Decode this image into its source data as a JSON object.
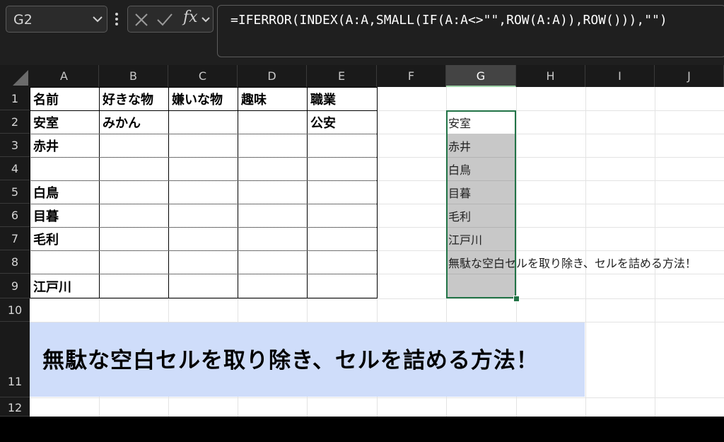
{
  "name_box": {
    "value": "G2"
  },
  "formula_bar": {
    "fx_label": "fx",
    "formula": "=IFERROR(INDEX(A:A,SMALL(IF(A:A<>\"\",ROW(A:A)),ROW())),\"\")"
  },
  "columns": [
    "A",
    "B",
    "C",
    "D",
    "E",
    "F",
    "G",
    "H",
    "I",
    "J"
  ],
  "rows": [
    "1",
    "2",
    "3",
    "4",
    "5",
    "6",
    "7",
    "8",
    "9",
    "10",
    "11",
    "12"
  ],
  "table": {
    "headers": [
      "名前",
      "好きな物",
      "嫌いな物",
      "趣味",
      "職業"
    ],
    "row2": {
      "a": "安室",
      "b": "みかん",
      "e": "公安"
    },
    "row3": {
      "a": "赤井"
    },
    "row5": {
      "a": "白鳥"
    },
    "row6": {
      "a": "目暮"
    },
    "row7": {
      "a": "毛利"
    },
    "row9": {
      "a": "江戸川"
    }
  },
  "result_column": [
    "安室",
    "赤井",
    "白鳥",
    "目暮",
    "毛利",
    "江戸川",
    "無駄な空白セルを取り除き、セルを詰める方法！"
  ],
  "banner": {
    "text": "無駄な空白セルを取り除き、セルを詰める方法！",
    "color": "#cfddfa"
  },
  "colors": {
    "selection": "#217346",
    "result_fill": "#c8c8c8",
    "header_bg": "#1a1a1a"
  }
}
